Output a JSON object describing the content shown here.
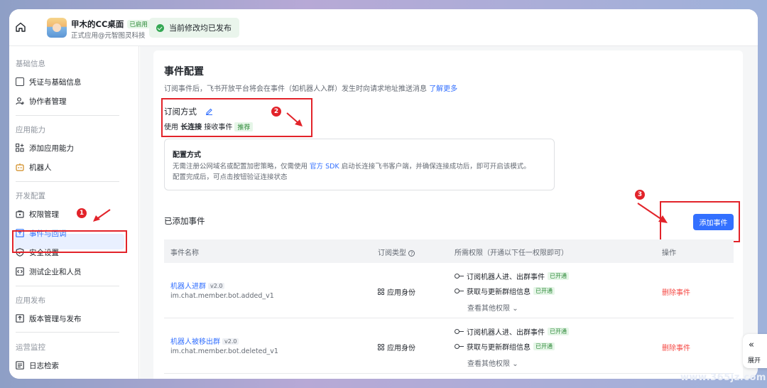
{
  "header": {
    "app_name": "甲木的CC桌面",
    "app_status": "已启用",
    "app_sub": "正式应用@元智图灵科技",
    "publish_status": "当前修改均已发布"
  },
  "sidebar": {
    "sections": [
      {
        "title": "基础信息",
        "items": [
          {
            "label": "凭证与基础信息",
            "icon": "id-card-icon"
          },
          {
            "label": "协作者管理",
            "icon": "user-add-icon"
          }
        ]
      },
      {
        "title": "应用能力",
        "items": [
          {
            "label": "添加应用能力",
            "icon": "apps-add-icon"
          },
          {
            "label": "机器人",
            "icon": "robot-icon"
          }
        ]
      },
      {
        "title": "开发配置",
        "items": [
          {
            "label": "权限管理",
            "icon": "permission-icon"
          },
          {
            "label": "事件与回调",
            "icon": "event-icon",
            "active": true
          },
          {
            "label": "安全设置",
            "icon": "shield-icon"
          },
          {
            "label": "测试企业和人员",
            "icon": "test-icon"
          }
        ]
      },
      {
        "title": "应用发布",
        "items": [
          {
            "label": "版本管理与发布",
            "icon": "upload-icon"
          }
        ]
      },
      {
        "title": "运营监控",
        "items": [
          {
            "label": "日志检索",
            "icon": "log-icon"
          }
        ]
      }
    ]
  },
  "annotations": [
    "1",
    "2",
    "3"
  ],
  "main": {
    "title": "事件配置",
    "desc": "订阅事件后，飞书开放平台将会在事件（如机器人入群）发生时向请求地址推送消息",
    "learn_more": "了解更多",
    "subscribe": {
      "title": "订阅方式",
      "line_prefix": "使用",
      "method": "长连接",
      "line_suffix": "接收事件",
      "tag": "推荐"
    },
    "config": {
      "title": "配置方式",
      "text_a": "无需注册公网域名或配置加密策略，仅需使用",
      "sdk_link": "官方 SDK",
      "text_b": "启动长连接飞书客户端，并确保连接成功后，即可开启该模式。",
      "text_c": "配置完成后，可点击按钮验证连接状态"
    },
    "added_title": "已添加事件",
    "add_button": "添加事件",
    "table": {
      "headers": [
        "事件名称",
        "订阅类型",
        "所需权限（开通以下任一权限即可）",
        "操作"
      ],
      "rows": [
        {
          "name": "机器人进群",
          "version": "v2.0",
          "code": "im.chat.member.bot.added_v1",
          "identity": "应用身份",
          "perms": [
            {
              "label": "订阅机器人进、出群事件",
              "tag": "已开通"
            },
            {
              "label": "获取与更新群组信息",
              "tag": "已开通"
            }
          ],
          "more": "查看其他权限",
          "action": "删除事件"
        },
        {
          "name": "机器人被移出群",
          "version": "v2.0",
          "code": "im.chat.member.bot.deleted_v1",
          "identity": "应用身份",
          "perms": [
            {
              "label": "订阅机器人进、出群事件",
              "tag": "已开通"
            },
            {
              "label": "获取与更新群组信息",
              "tag": "已开通"
            }
          ],
          "more": "查看其他权限",
          "action": "删除事件"
        }
      ]
    }
  },
  "float_button": {
    "label": "展开"
  },
  "watermark": "www.365jz.com"
}
